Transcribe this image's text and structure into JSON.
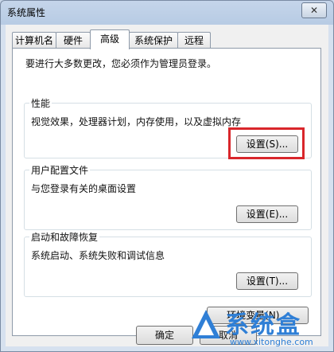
{
  "window": {
    "title": "系统属性",
    "close_label": "✕"
  },
  "tabs": [
    {
      "label": "计算机名"
    },
    {
      "label": "硬件"
    },
    {
      "label": "高级"
    },
    {
      "label": "系统保护"
    },
    {
      "label": "远程"
    }
  ],
  "notice": "要进行大多数更改，您必须作为管理员登录。",
  "performance": {
    "title": "性能",
    "desc": "视觉效果，处理器计划，内存使用，以及虚拟内存",
    "button": "设置(S)..."
  },
  "profiles": {
    "title": "用户配置文件",
    "desc": "与您登录有关的桌面设置",
    "button": "设置(E)..."
  },
  "startup": {
    "title": "启动和故障恢复",
    "desc": "系统启动、系统失败和调试信息",
    "button": "设置(T)..."
  },
  "env_button": "环境变量(N)...",
  "footer": {
    "ok": "确定",
    "cancel": "取消"
  },
  "watermark": {
    "name": "系统盒",
    "url": "www.xitonghe.com"
  },
  "colors": {
    "highlight": "#d9262b",
    "watermark": "#2f7fd6"
  }
}
